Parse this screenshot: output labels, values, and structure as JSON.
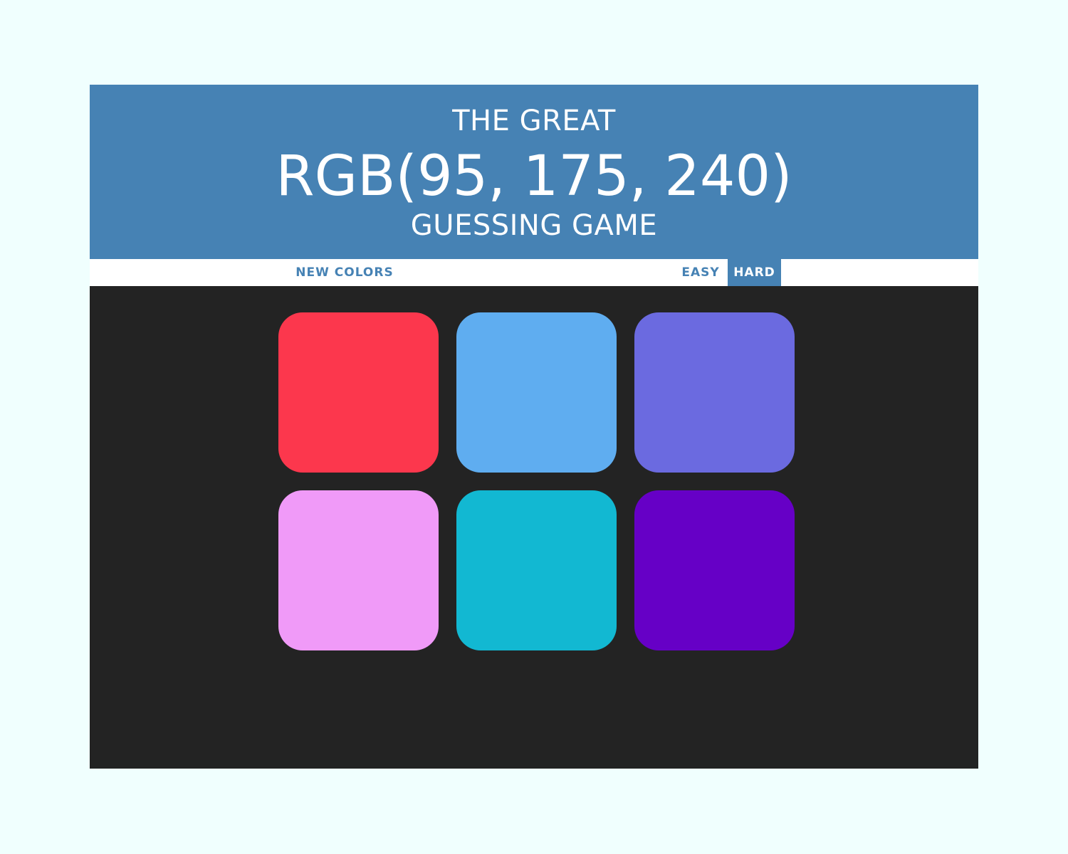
{
  "header": {
    "title_top": "THE GREAT",
    "target_color": "RGB(95, 175, 240)",
    "title_bottom": "GUESSING GAME",
    "background_color": "#4682b4"
  },
  "stripe": {
    "new_colors_label": "NEW COLORS",
    "easy_label": "EASY",
    "hard_label": "HARD",
    "selected_mode": "HARD"
  },
  "board": {
    "background_color": "#232323",
    "squares": [
      {
        "color": "#fc374d"
      },
      {
        "color": "#5fadf0"
      },
      {
        "color": "#6b6ae0"
      },
      {
        "color": "#f09af8"
      },
      {
        "color": "#12b8d2"
      },
      {
        "color": "#6600c6"
      }
    ]
  }
}
